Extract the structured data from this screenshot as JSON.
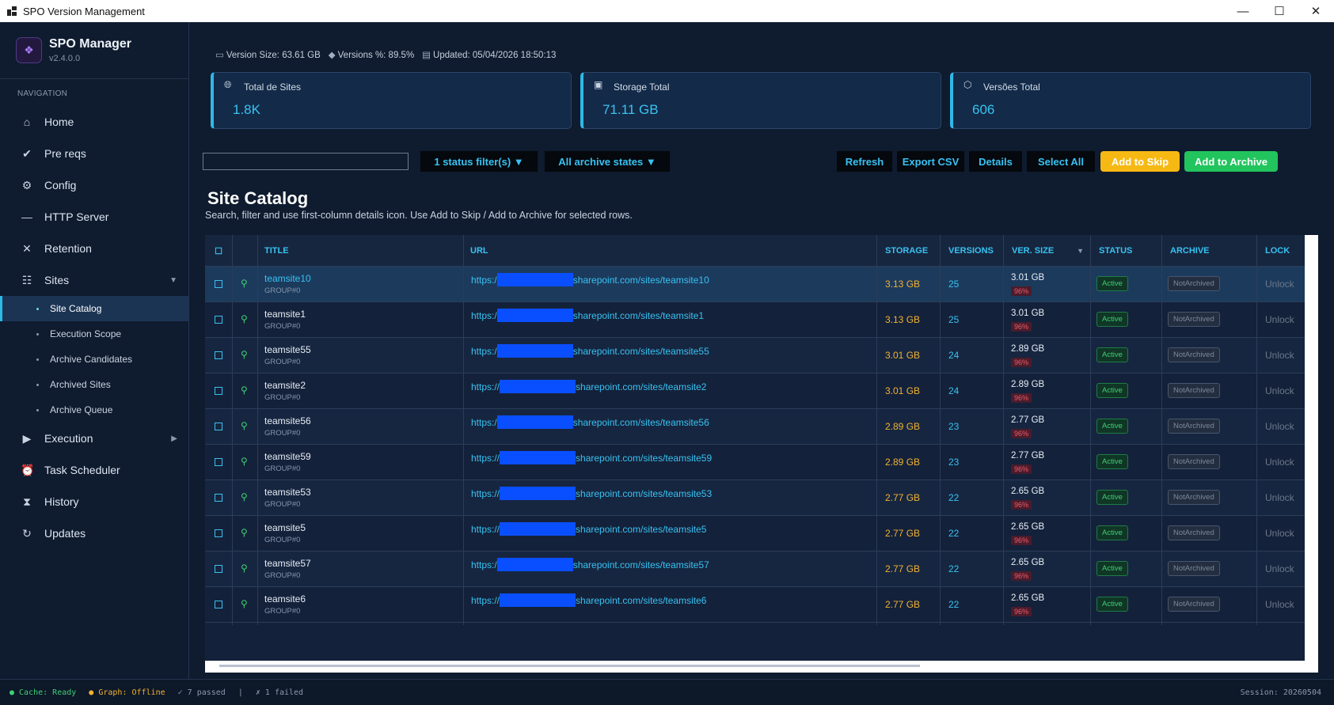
{
  "window": {
    "title": "SPO Version Management",
    "controls": [
      "—",
      "☐",
      "✕"
    ]
  },
  "sidebar": {
    "brand_name": "SPO Manager",
    "brand_version": "v2.4.0.0",
    "nav_heading": "NAVIGATION",
    "items": [
      {
        "label": "Home",
        "icon": "home-icon"
      },
      {
        "label": "Pre reqs",
        "icon": "check-icon"
      },
      {
        "label": "Config",
        "icon": "gear-icon"
      },
      {
        "label": "HTTP Server",
        "icon": "dash-icon"
      },
      {
        "label": "Retention",
        "icon": "x-icon"
      },
      {
        "label": "Sites",
        "icon": "list-icon"
      }
    ],
    "sites_sub": [
      {
        "label": "Site Catalog",
        "active": true
      },
      {
        "label": "Execution Scope"
      },
      {
        "label": "Archive Candidates"
      },
      {
        "label": "Archived Sites"
      },
      {
        "label": "Archive Queue"
      }
    ],
    "items2": [
      {
        "label": "Execution",
        "icon": "play-icon"
      },
      {
        "label": "Task Scheduler",
        "icon": "alarm-icon"
      },
      {
        "label": "History",
        "icon": "hourglass-icon"
      },
      {
        "label": "Updates",
        "icon": "refresh-icon"
      }
    ]
  },
  "meta": {
    "version_size": "Version Size: 63.61 GB",
    "versions_pct": "Versions %: 89.5%",
    "updated": "Updated: 05/04/2026 18:50:13"
  },
  "cards": [
    {
      "label": "Total de Sites",
      "value": "1.8K",
      "icon": "globe-icon"
    },
    {
      "label": "Storage Total",
      "value": "71.11 GB",
      "icon": "disk-icon"
    },
    {
      "label": "Versões Total",
      "value": "606",
      "icon": "box-icon"
    }
  ],
  "toolbar": {
    "search_value": "",
    "status_filter": "1 status filter(s) ▼",
    "archive_filter": "All archive states ▼",
    "refresh": "Refresh",
    "export": "Export CSV",
    "details": "Details",
    "select_all": "Select All",
    "add_skip": "Add to Skip",
    "add_archive": "Add to Archive"
  },
  "catalog": {
    "title": "Site Catalog",
    "subtitle": "Search, filter and use first-column details icon. Use Add to Skip / Add to Archive for selected rows."
  },
  "table": {
    "headers": {
      "check": "☐",
      "title": "TITLE",
      "url": "URL",
      "storage": "STORAGE",
      "versions": "VERSIONS",
      "ver_size": "VER. SIZE",
      "ver_size_sort": "▼",
      "status": "STATUS",
      "archive": "ARCHIVE",
      "lock": "LOCK"
    },
    "rows": [
      {
        "title": "teamsite10",
        "group": "GROUP#0",
        "url_pre": "https:/",
        "url_post": "sharepoint.com/sites/teamsite10",
        "storage": "3.13 GB",
        "versions": "25",
        "ver_size": "3.01 GB",
        "pct": "96%",
        "status": "Active",
        "archive": "NotArchived",
        "lock": "Unlock"
      },
      {
        "title": "teamsite1",
        "group": "GROUP#0",
        "url_pre": "https:/",
        "url_post": "sharepoint.com/sites/teamsite1",
        "storage": "3.13 GB",
        "versions": "25",
        "ver_size": "3.01 GB",
        "pct": "96%",
        "status": "Active",
        "archive": "NotArchived",
        "lock": "Unlock"
      },
      {
        "title": "teamsite55",
        "group": "GROUP#0",
        "url_pre": "https:/",
        "url_post": "sharepoint.com/sites/teamsite55",
        "storage": "3.01 GB",
        "versions": "24",
        "ver_size": "2.89 GB",
        "pct": "96%",
        "status": "Active",
        "archive": "NotArchived",
        "lock": "Unlock"
      },
      {
        "title": "teamsite2",
        "group": "GROUP#0",
        "url_pre": "https://",
        "url_post": "sharepoint.com/sites/teamsite2",
        "storage": "3.01 GB",
        "versions": "24",
        "ver_size": "2.89 GB",
        "pct": "96%",
        "status": "Active",
        "archive": "NotArchived",
        "lock": "Unlock"
      },
      {
        "title": "teamsite56",
        "group": "GROUP#0",
        "url_pre": "https:/",
        "url_post": "sharepoint.com/sites/teamsite56",
        "storage": "2.89 GB",
        "versions": "23",
        "ver_size": "2.77 GB",
        "pct": "96%",
        "status": "Active",
        "archive": "NotArchived",
        "lock": "Unlock"
      },
      {
        "title": "teamsite59",
        "group": "GROUP#0",
        "url_pre": "https://",
        "url_post": "sharepoint.com/sites/teamsite59",
        "storage": "2.89 GB",
        "versions": "23",
        "ver_size": "2.77 GB",
        "pct": "96%",
        "status": "Active",
        "archive": "NotArchived",
        "lock": "Unlock"
      },
      {
        "title": "teamsite53",
        "group": "GROUP#0",
        "url_pre": "https://",
        "url_post": "sharepoint.com/sites/teamsite53",
        "storage": "2.77 GB",
        "versions": "22",
        "ver_size": "2.65 GB",
        "pct": "96%",
        "status": "Active",
        "archive": "NotArchived",
        "lock": "Unlock"
      },
      {
        "title": "teamsite5",
        "group": "GROUP#0",
        "url_pre": "https://",
        "url_post": "sharepoint.com/sites/teamsite5",
        "storage": "2.77 GB",
        "versions": "22",
        "ver_size": "2.65 GB",
        "pct": "96%",
        "status": "Active",
        "archive": "NotArchived",
        "lock": "Unlock"
      },
      {
        "title": "teamsite57",
        "group": "GROUP#0",
        "url_pre": "https:/",
        "url_post": "sharepoint.com/sites/teamsite57",
        "storage": "2.77 GB",
        "versions": "22",
        "ver_size": "2.65 GB",
        "pct": "96%",
        "status": "Active",
        "archive": "NotArchived",
        "lock": "Unlock"
      },
      {
        "title": "teamsite6",
        "group": "GROUP#0",
        "url_pre": "https://",
        "url_post": "sharepoint.com/sites/teamsite6",
        "storage": "2.77 GB",
        "versions": "22",
        "ver_size": "2.65 GB",
        "pct": "96%",
        "status": "Active",
        "archive": "NotArchived",
        "lock": "Unlock"
      }
    ]
  },
  "statusbar": {
    "cache": "● Cache: Ready",
    "graph": "● Graph: Offline",
    "passed": "✓ 7 passed",
    "sep": "|",
    "failed": "✗ 1 failed",
    "session": "Session: 20260504"
  }
}
